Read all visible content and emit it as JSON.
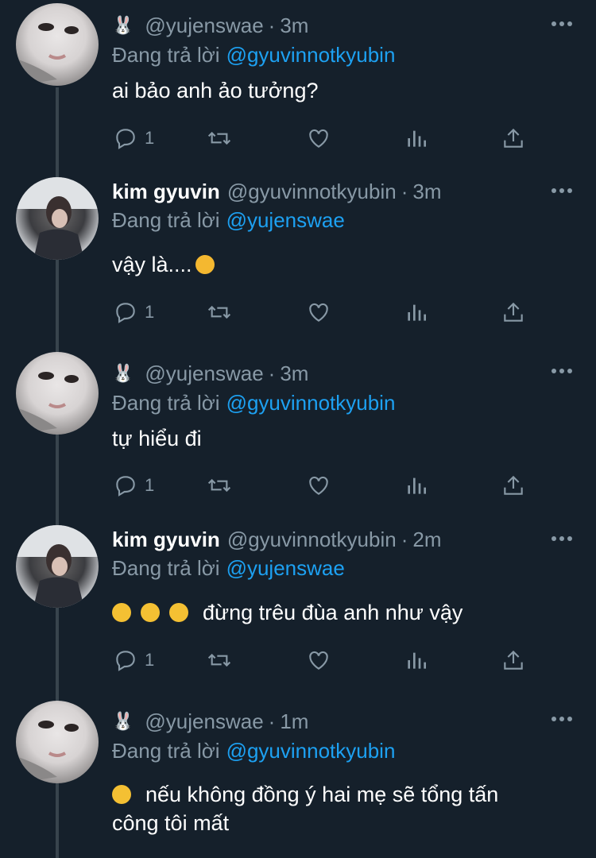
{
  "colors": {
    "background": "#15202b",
    "text": "#ffffff",
    "secondary": "#8899a6",
    "link": "#1da1f2",
    "thread_line": "#38444d"
  },
  "reply_prefix": "Đang trả lời",
  "tweets": [
    {
      "name_emoji": "🐰",
      "handle": "@yujenswae",
      "time": "3m",
      "reply_to": "@gyuvinnotkyubin",
      "text": "ai bảo anh ảo tưởng?",
      "reply_count": "1"
    },
    {
      "name": "kim gyuvin",
      "handle": "@gyuvinnotkyubin",
      "time": "3m",
      "reply_to": "@yujenswae",
      "text": "vậy là....",
      "reply_count": "1"
    },
    {
      "name_emoji": "🐰",
      "handle": "@yujenswae",
      "time": "3m",
      "reply_to": "@gyuvinnotkyubin",
      "text": "tự hiểu đi",
      "reply_count": "1"
    },
    {
      "name": "kim gyuvin",
      "handle": "@gyuvinnotkyubin",
      "time": "2m",
      "reply_to": "@yujenswae",
      "text": "đừng trêu đùa anh như vậy",
      "reply_count": "1"
    },
    {
      "name_emoji": "🐰",
      "handle": "@yujenswae",
      "time": "1m",
      "reply_to": "@gyuvinnotkyubin",
      "text_line1": "nếu không đồng ý hai mẹ sẽ tổng tấn",
      "text_line2": "công tôi mất"
    }
  ],
  "icons": [
    "reply-icon",
    "retweet-icon",
    "like-icon",
    "analytics-icon",
    "share-icon",
    "more-icon",
    "rabbit-emoji",
    "star-struck-emoji",
    "crying-emoji",
    "unamused-emoji"
  ]
}
